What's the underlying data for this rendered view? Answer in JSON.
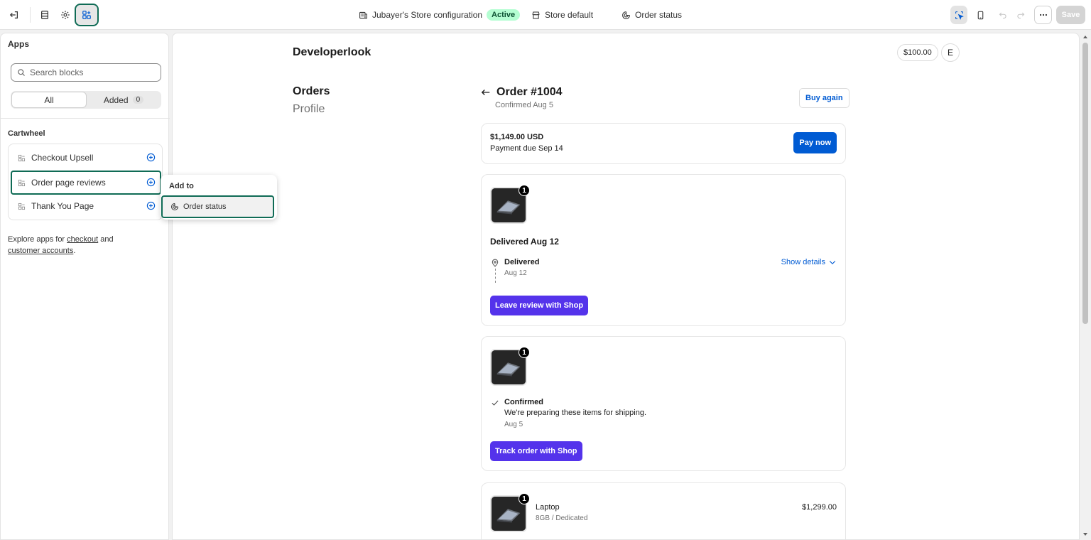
{
  "topbar": {
    "store_config": "Jubayer's Store configuration",
    "status_badge": "Active",
    "store_default": "Store default",
    "page_selector": "Order status",
    "save": "Save"
  },
  "sidebar": {
    "title": "Apps",
    "search_placeholder": "Search blocks",
    "tabs": {
      "all": "All",
      "added": "Added",
      "added_count": "0"
    },
    "group_title": "Cartwheel",
    "apps": [
      {
        "label": "Checkout Upsell"
      },
      {
        "label": "Order page reviews"
      },
      {
        "label": "Thank You Page"
      }
    ],
    "explore": {
      "prefix": "Explore apps for",
      "checkout": "checkout",
      "and": "and",
      "customer_accounts": "customer accounts",
      "suffix": "."
    }
  },
  "popover": {
    "title": "Add to",
    "item": "Order status"
  },
  "preview": {
    "shop_name": "Developerlook",
    "balance": "$100.00",
    "avatar": "E",
    "nav": {
      "orders": "Orders",
      "profile": "Profile"
    },
    "order": {
      "title": "Order #1004",
      "subtitle": "Confirmed Aug 5",
      "buy_again": "Buy again"
    },
    "payment": {
      "amount": "$1,149.00 USD",
      "due": "Payment due Sep 14",
      "pay_now": "Pay now"
    },
    "delivered_card": {
      "qty": "1",
      "title": "Delivered Aug 12",
      "event": "Delivered",
      "date": "Aug 12",
      "show_details": "Show details",
      "button": "Leave review with Shop"
    },
    "confirmed_card": {
      "qty": "1",
      "event": "Confirmed",
      "note": "We're preparing these items for shipping.",
      "date": "Aug 5",
      "button": "Track order with Shop"
    },
    "line_item": {
      "qty": "1",
      "name": "Laptop",
      "variant": "8GB / Dedicated",
      "price": "$1,299.00"
    }
  },
  "colors": {
    "accent_selected": "#0f6b55",
    "link_blue": "#005bd3",
    "shop_purple": "#5433eb",
    "active_badge": "#b4fed2"
  },
  "icons": {
    "exit": "exit-icon",
    "sections": "sections-icon",
    "settings": "gear-icon",
    "apps": "apps-icon",
    "store": "store-icon",
    "order": "order-status-icon",
    "inspector": "cursor-select-icon",
    "mobile": "mobile-icon",
    "undo": "undo-icon",
    "redo": "redo-icon",
    "more": "more-icon"
  }
}
